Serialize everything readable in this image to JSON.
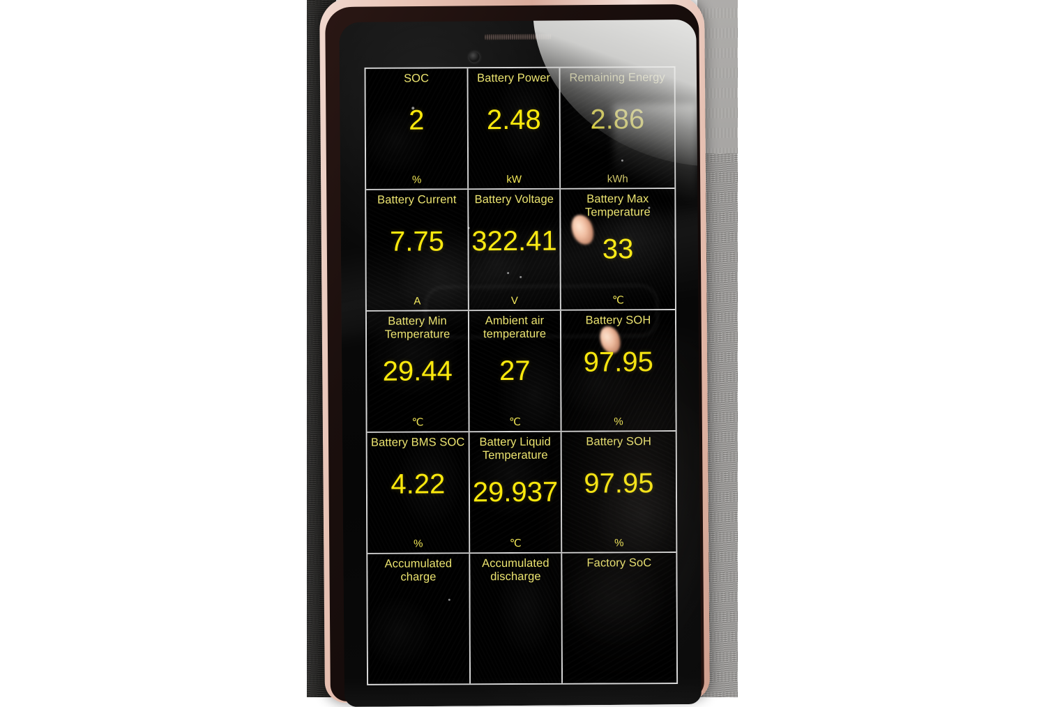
{
  "scene": {
    "subject": "smartphone-photo",
    "device_frame_color": "#e8c4b6",
    "screen_background": "#000000"
  },
  "app": {
    "accent_value_color": "#fbe90d",
    "accent_label_color": "#ece470",
    "grid_line_color": "#d8d8d8",
    "rows": [
      {
        "cells": [
          {
            "label": "SOC",
            "value": "2",
            "unit": "%"
          },
          {
            "label": "Battery Power",
            "value": "2.48",
            "unit": "kW"
          },
          {
            "label": "Remaining Energy",
            "value": "2.86",
            "unit": "kWh"
          }
        ]
      },
      {
        "cells": [
          {
            "label": "Battery Current",
            "value": "7.75",
            "unit": "A"
          },
          {
            "label": "Battery Voltage",
            "value": "322.41",
            "unit": "V"
          },
          {
            "label": "Battery Max Temperature",
            "value": "33",
            "unit": "℃"
          }
        ]
      },
      {
        "cells": [
          {
            "label": "Battery Min Temperature",
            "value": "29.44",
            "unit": "℃"
          },
          {
            "label": "Ambient air temperature",
            "value": "27",
            "unit": "℃"
          },
          {
            "label": "Battery SOH",
            "value": "97.95",
            "unit": "%"
          }
        ]
      },
      {
        "cells": [
          {
            "label": "Battery BMS SOC",
            "value": "4.22",
            "unit": "%"
          },
          {
            "label": "Battery Liquid Temperature",
            "value": "29.937",
            "unit": "℃"
          },
          {
            "label": "Battery SOH",
            "value": "97.95",
            "unit": "%"
          }
        ]
      },
      {
        "cells": [
          {
            "label": "Accumulated charge",
            "value": "",
            "unit": ""
          },
          {
            "label": "Accumulated discharge",
            "value": "",
            "unit": ""
          },
          {
            "label": "Factory SoC",
            "value": "",
            "unit": ""
          }
        ]
      }
    ]
  },
  "hardware": {
    "earpiece": "earpiece-speaker-grille",
    "camera": "front-camera-lens"
  }
}
